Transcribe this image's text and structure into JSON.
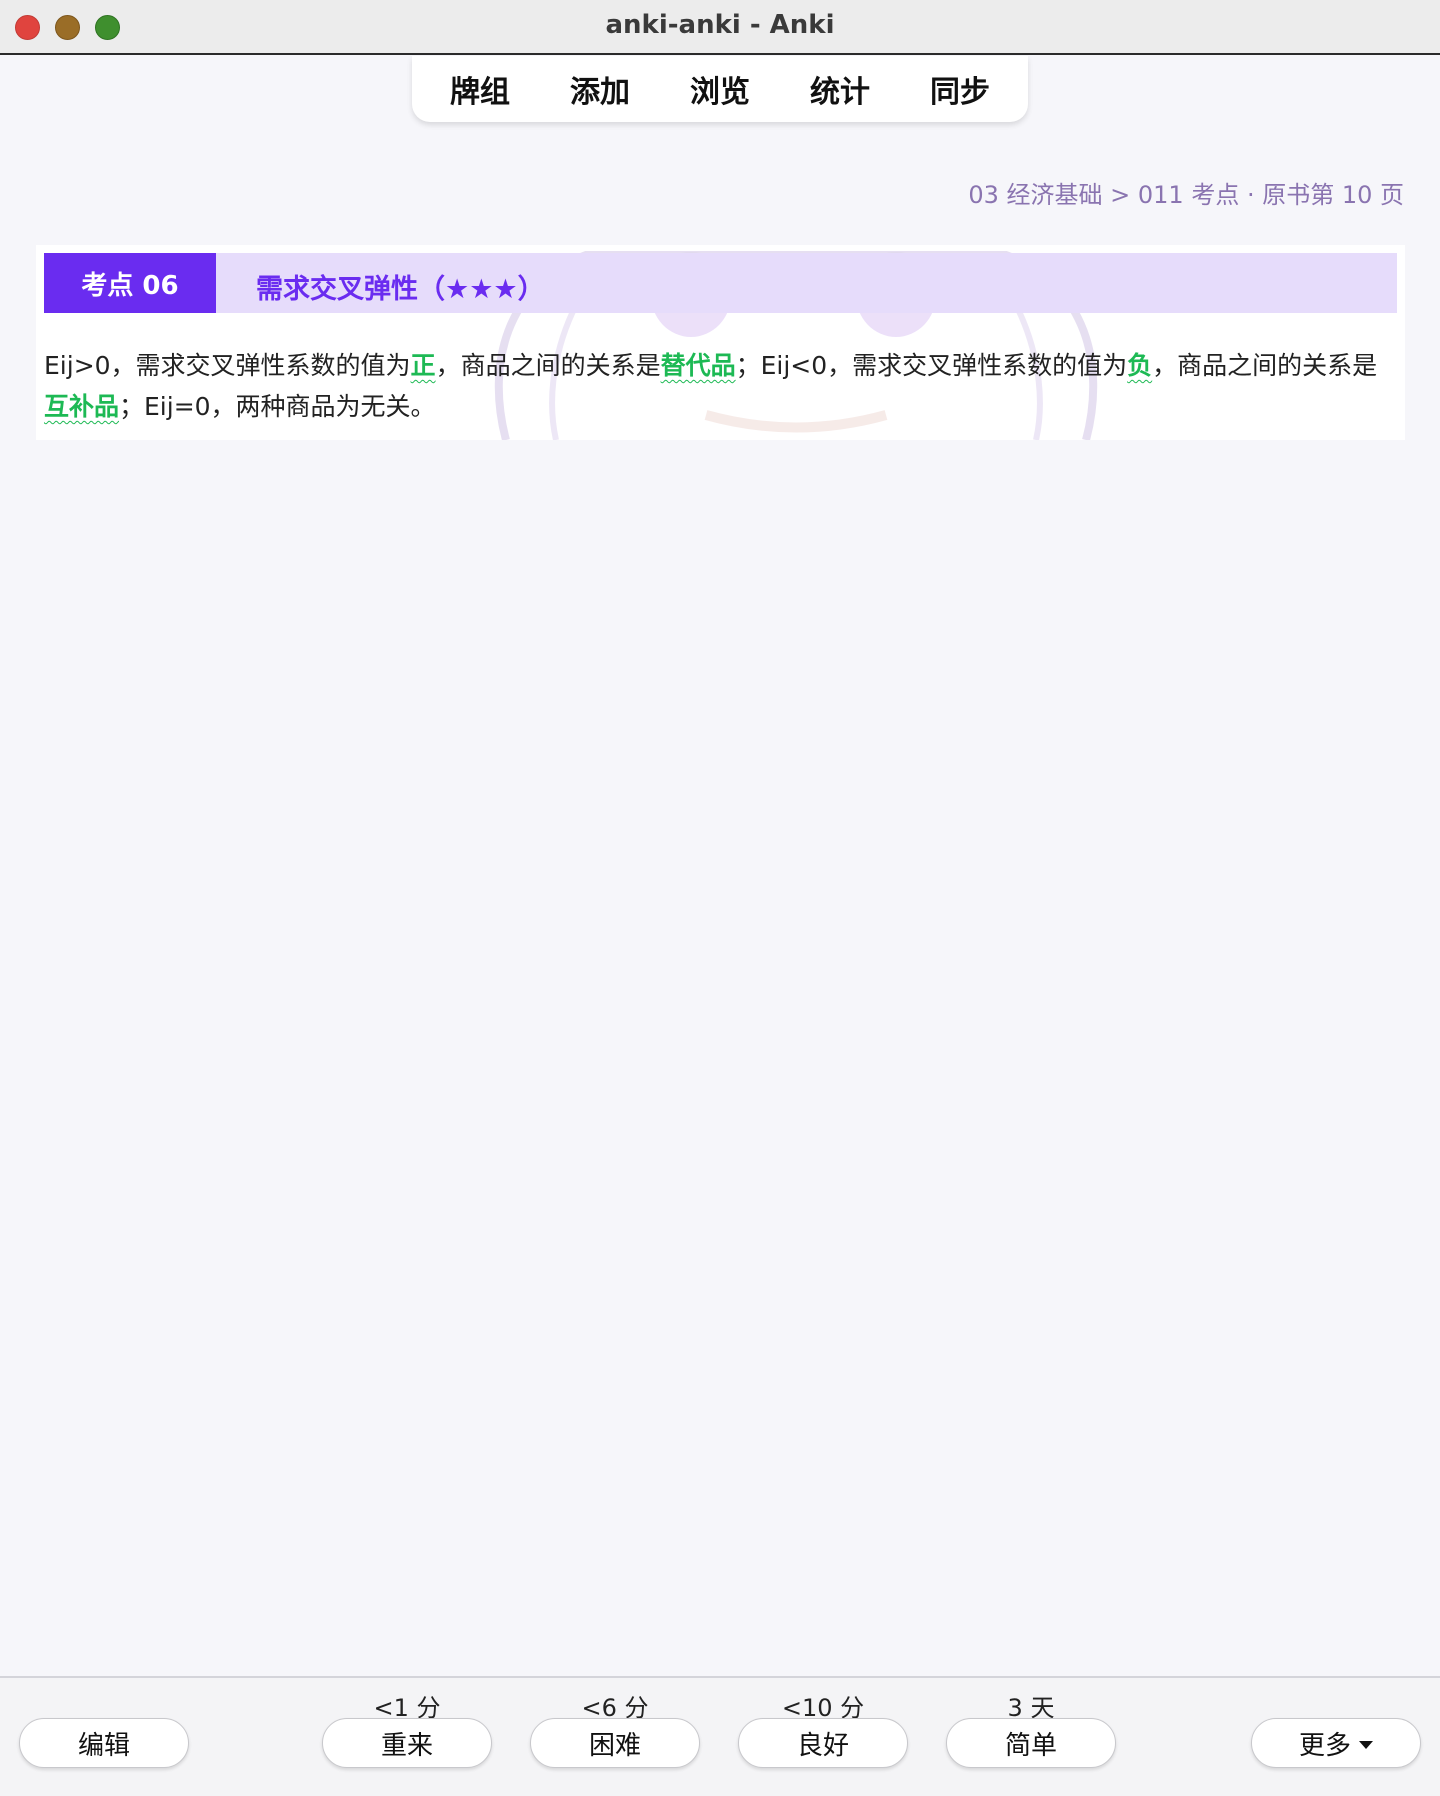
{
  "window": {
    "title": "anki-anki - Anki"
  },
  "toolbar": {
    "items": [
      {
        "label": "牌组"
      },
      {
        "label": "添加"
      },
      {
        "label": "浏览"
      },
      {
        "label": "统计"
      },
      {
        "label": "同步"
      }
    ]
  },
  "breadcrumb": {
    "text": "03 经济基础 > 011 考点 · 原书第 10 页"
  },
  "card": {
    "badge": "考点 06",
    "title": "需求交叉弹性（★★★）",
    "body": {
      "p1": "Eij>0，需求交叉弹性系数的值为",
      "h1": "正",
      "p2": "，商品之间的关系是",
      "h2": "替代品",
      "p3": "；Eij<0，需求交叉弹性系数的值为",
      "h3": "负",
      "p4": "，商品之间的关系是",
      "h4": "互补品",
      "p5": "；Eij=0，两种商品为无关。"
    }
  },
  "answer_bar": {
    "edit_label": "编辑",
    "more_label": "更多",
    "buttons": [
      {
        "interval": "<1 分",
        "label": "重来"
      },
      {
        "interval": "<6 分",
        "label": "困难"
      },
      {
        "interval": "<10 分",
        "label": "良好"
      },
      {
        "interval": "3 天",
        "label": "简单"
      }
    ]
  },
  "colors": {
    "accent_purple": "#6a2cf0",
    "header_bg": "#e6dcfb",
    "highlight_green": "#1db954",
    "breadcrumb": "#8a74b0"
  }
}
